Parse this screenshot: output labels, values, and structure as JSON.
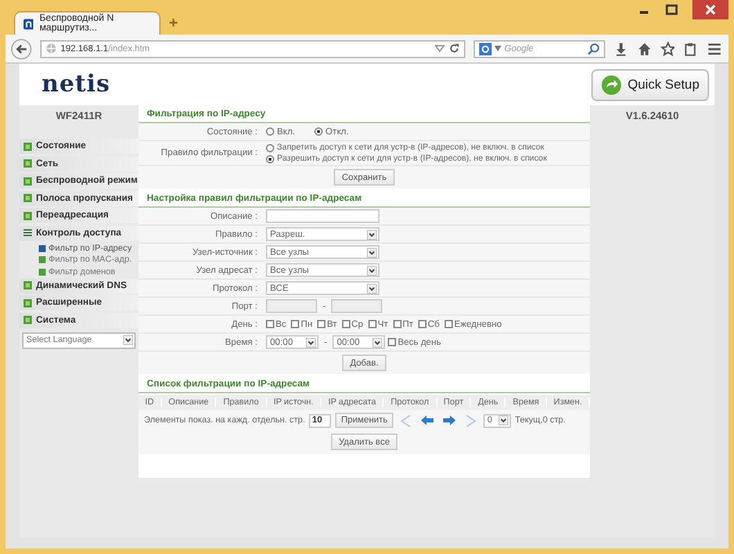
{
  "browser": {
    "tab_title": "Беспроводной N маршрутиз...",
    "new_tab": "+",
    "url_host": "192.168.1.1",
    "url_path": "/index.htm",
    "search_placeholder": "Google"
  },
  "header": {
    "logo": "netis",
    "quick_setup": "Quick Setup"
  },
  "sidebar": {
    "model": "WF2411R",
    "items": [
      {
        "label": "Состояние",
        "expanded": false
      },
      {
        "label": "Сеть",
        "expanded": false
      },
      {
        "label": "Беспроводной режим",
        "expanded": false
      },
      {
        "label": "Полоса пропускания",
        "expanded": false
      },
      {
        "label": "Переадресация",
        "expanded": false
      },
      {
        "label": "Контроль доступа",
        "expanded": true,
        "children": [
          {
            "label": "Фильтр по IP-адресу",
            "selected": true
          },
          {
            "label": "Фильтр по MAC-адр.",
            "selected": false
          },
          {
            "label": "Фильтр доменов",
            "selected": false
          }
        ]
      },
      {
        "label": "Динамический DNS",
        "expanded": false
      },
      {
        "label": "Расширенные",
        "expanded": false
      },
      {
        "label": "Система",
        "expanded": false
      }
    ],
    "language": "Select Language"
  },
  "version": "V1.6.24610",
  "ip_filter": {
    "title": "Фильтрация по IP-адресу",
    "state_label": "Состояние :",
    "states": [
      {
        "label": "Вкл.",
        "selected": false
      },
      {
        "label": "Откл.",
        "selected": true
      }
    ],
    "rule_label": "Правило фильтрации :",
    "rules": [
      {
        "label": "Запретить доступ к сети для устр-в (IP-адресов), не включ. в список",
        "selected": false
      },
      {
        "label": "Разрешить доступ к сети для устр-в (IP-адресов), не включ. в список",
        "selected": true
      }
    ],
    "save": "Сохранить"
  },
  "rule_settings": {
    "title": "Настройка правил фильтрации по IP-адресам",
    "fields": [
      {
        "kind": "text",
        "label": "Описание :"
      },
      {
        "kind": "select",
        "label": "Правило :",
        "value": "Разреш."
      },
      {
        "kind": "select",
        "label": "Узел-источник :",
        "value": "Все узлы"
      },
      {
        "kind": "select",
        "label": "Узел адресат :",
        "value": "Все узлы"
      },
      {
        "kind": "select",
        "label": "Протокол :",
        "value": "ВСЕ"
      },
      {
        "kind": "range",
        "label": "Порт :",
        "separator": "-",
        "disabled": true
      },
      {
        "kind": "days",
        "label": "День :",
        "days": [
          {
            "label": "Вс",
            "checked": false
          },
          {
            "label": "Пн",
            "checked": false
          },
          {
            "label": "Вт",
            "checked": false
          },
          {
            "label": "Ср",
            "checked": false
          },
          {
            "label": "Чт",
            "checked": false
          },
          {
            "label": "Пт",
            "checked": false
          },
          {
            "label": "Сб",
            "checked": false
          },
          {
            "label": "Ежедневно",
            "checked": false
          }
        ]
      },
      {
        "kind": "time",
        "label": "Время :",
        "from": "00:00",
        "separator": "-",
        "to": "00:00",
        "all_day": {
          "label": "Весь день",
          "checked": false
        }
      }
    ],
    "add": "Добав."
  },
  "filter_list": {
    "title": "Список фильтрации по IP-адресам",
    "columns": [
      "ID",
      "Описание",
      "Правило",
      "IP источн.",
      "IP адресата",
      "Протокол",
      "Порт",
      "День",
      "Время",
      "Измен."
    ],
    "per_page_label": "Элементы показ. на кажд. отдельн. стр.",
    "per_page": "10",
    "apply": "Применить",
    "page": "0",
    "page_info": "Текущ,0 стр.",
    "delete_all": "Удалить все"
  }
}
